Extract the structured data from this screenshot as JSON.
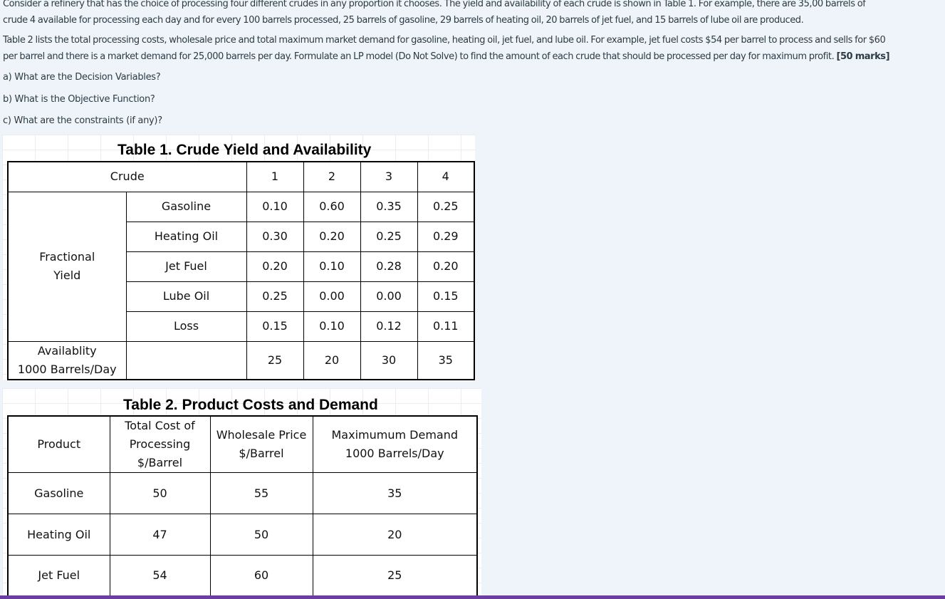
{
  "question": {
    "paragraph1_line1": "Consider a refinery that has the choice of processing four different crudes in any proportion it chooses. The yield and availability of each crude is shown in Table 1. For example, there are 35,00 barrels of",
    "paragraph1_line2": "crude 4 available for processing each day and for every 100 barrels processed, 25 barrels of gasoline, 29 barrels of heating oil, 20 barrels of jet fuel, and 15 barrels of lube oil are produced.",
    "paragraph2_line1": "Table 2 lists the total processing costs, wholesale price and total maximum market demand for gasoline, heating oil, jet fuel, and lube oil. For example, jet fuel costs $54 per barrel to process and sells for $60",
    "paragraph2_line2": "per barrel and there is a market demand for 25,000 barrels per day. Formulate an LP model (Do Not Solve) to find the amount of each crude that should be processed per day for maximum profit.",
    "marks": "[50 marks]",
    "part_a": "a) What are the Decision Variables?",
    "part_b": "b) What is the Objective Function?",
    "part_c": "c) What are the constraints (if any)?"
  },
  "table1": {
    "title": "Table 1. Crude Yield and Availability",
    "crude_header": "Crude",
    "crudes": [
      "1",
      "2",
      "3",
      "4"
    ],
    "yield_label_line1": "Fractional",
    "yield_label_line2": "Yield",
    "rows": [
      {
        "product": "Gasoline",
        "values": [
          "0.10",
          "0.60",
          "0.35",
          "0.25"
        ]
      },
      {
        "product": "Heating Oil",
        "values": [
          "0.30",
          "0.20",
          "0.25",
          "0.29"
        ]
      },
      {
        "product": "Jet Fuel",
        "values": [
          "0.20",
          "0.10",
          "0.28",
          "0.20"
        ]
      },
      {
        "product": "Lube Oil",
        "values": [
          "0.25",
          "0.00",
          "0.00",
          "0.15"
        ]
      },
      {
        "product": "Loss",
        "values": [
          "0.15",
          "0.10",
          "0.12",
          "0.11"
        ]
      }
    ],
    "availability_label_line1": "Availablity",
    "availability_label_line2": "1000 Barrels/Day",
    "availability": [
      "25",
      "20",
      "30",
      "35"
    ]
  },
  "table2": {
    "title": "Table 2. Product Costs and Demand",
    "header_product": "Product",
    "header_cost_line1": "Total Cost of",
    "header_cost_line2": "Processing",
    "header_cost_line3": "$/Barrel",
    "header_price_line1": "Wholesale Price",
    "header_price_line2": "$/Barrel",
    "header_demand_line1": "Maximumum Demand",
    "header_demand_line2": "1000 Barrels/Day",
    "rows": [
      {
        "product": "Gasoline",
        "cost": "50",
        "price": "55",
        "demand": "35"
      },
      {
        "product": "Heating Oil",
        "cost": "47",
        "price": "50",
        "demand": "20"
      },
      {
        "product": "Jet Fuel",
        "cost": "54",
        "price": "60",
        "demand": "25"
      }
    ]
  }
}
